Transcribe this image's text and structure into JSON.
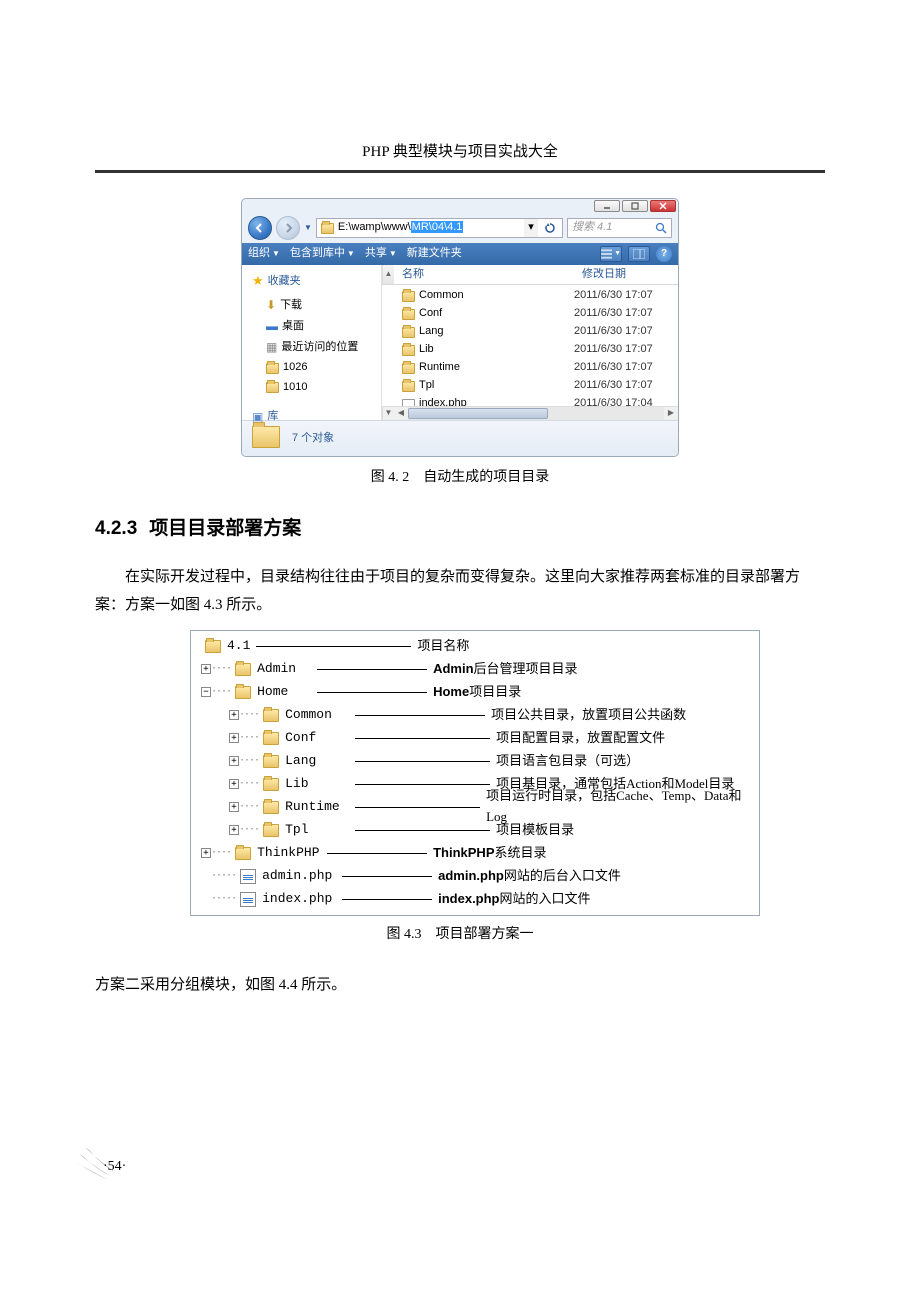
{
  "book_title": "PHP 典型模块与项目实战大全",
  "explorer": {
    "path_prefix": "E:\\wamp\\www\\",
    "path_highlight": "MR\\04\\4.1",
    "search_placeholder": "搜索 4.1",
    "toolbar": {
      "organize": "组织",
      "include": "包含到库中",
      "share": "共享",
      "newfolder": "新建文件夹"
    },
    "sidebar": {
      "favorites": "收藏夹",
      "download": "下载",
      "desktop": "桌面",
      "recent": "最近访问的位置",
      "folder1": "1026",
      "folder2": "1010",
      "library": "库"
    },
    "columns": {
      "name": "名称",
      "date": "修改日期"
    },
    "files": [
      {
        "name": "Common",
        "date": "2011/6/30 17:07",
        "type": "folder"
      },
      {
        "name": "Conf",
        "date": "2011/6/30 17:07",
        "type": "folder"
      },
      {
        "name": "Lang",
        "date": "2011/6/30 17:07",
        "type": "folder"
      },
      {
        "name": "Lib",
        "date": "2011/6/30 17:07",
        "type": "folder"
      },
      {
        "name": "Runtime",
        "date": "2011/6/30 17:07",
        "type": "folder"
      },
      {
        "name": "Tpl",
        "date": "2011/6/30 17:07",
        "type": "folder"
      },
      {
        "name": "index.php",
        "date": "2011/6/30 17:04",
        "type": "php"
      }
    ],
    "status": "7 个对象"
  },
  "caption_4_2": "图 4. 2　自动生成的项目目录",
  "section_4_2_3": {
    "num": "4.2.3",
    "title": "项目目录部署方案"
  },
  "para_4_2_3": "在实际开发过程中，目录结构往往由于项目的复杂而变得复杂。这里向大家推荐两套标准的目录部署方案：方案一如图 4.3 所示。",
  "diagram": {
    "root_label": "4.1",
    "root_desc": "项目名称",
    "admin_label": "Admin",
    "admin_desc_b": "Admin",
    "admin_desc": "后台管理项目目录",
    "home_label": "Home",
    "home_desc_b": "Home",
    "home_desc": "项目目录",
    "sub": [
      {
        "label": "Common",
        "desc": "项目公共目录，放置项目公共函数"
      },
      {
        "label": "Conf",
        "desc": "项目配置目录，放置配置文件"
      },
      {
        "label": "Lang",
        "desc": "项目语言包目录（可选）"
      },
      {
        "label": "Lib",
        "desc": "项目基目录，通常包括Action和Model目录"
      },
      {
        "label": "Runtime",
        "desc": "项目运行时目录，包括Cache、Temp、Data和Log"
      },
      {
        "label": "Tpl",
        "desc": "项目模板目录"
      }
    ],
    "thinkphp_label": "ThinkPHP",
    "thinkphp_desc_b": "ThinkPHP",
    "thinkphp_desc": "系统目录",
    "admin_php_label": "admin.php",
    "admin_php_desc_b": "admin.php",
    "admin_php_desc": "网站的后台入口文件",
    "index_php_label": "index.php",
    "index_php_desc_b": "index.php",
    "index_php_desc": "网站的入口文件"
  },
  "caption_4_3": "图 4.3　项目部署方案一",
  "para_after": "方案二采用分组模块，如图 4.4 所示。",
  "page_number": "·54·"
}
